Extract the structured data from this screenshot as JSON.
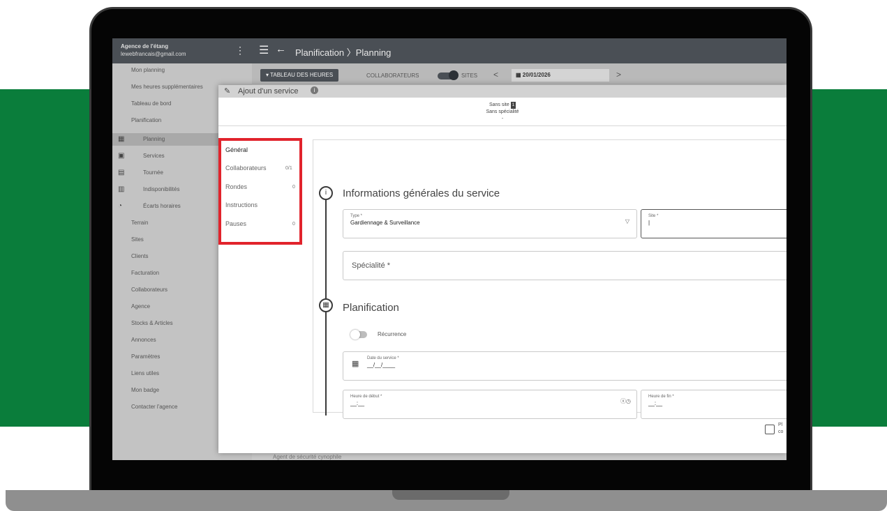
{
  "colors": {
    "green": "#0a7d3b",
    "highlight_red": "#e1232c",
    "topbar": "#4a4f55"
  },
  "account": {
    "agency_name": "Agence de l'étang",
    "email": "lewebfrancais@gmail.com"
  },
  "topbar": {
    "breadcrumb": "Planification 〉Planning",
    "menu_icon": "hamburger-icon",
    "back_icon": "arrow-left-icon"
  },
  "subbar": {
    "tableau": "TABLEAU DES HEURES",
    "collaborateurs": "COLLABORATEURS",
    "sites": "SITES",
    "prev": "<",
    "next": ">",
    "date": "20/01/2026"
  },
  "sidebar": {
    "mon_planning": "Mon planning",
    "mes_heures": "Mes heures supplémentaires",
    "tableau_de_bord": "Tableau de bord",
    "planification": "Planification",
    "planning": "Planning",
    "services": "Services",
    "tournee": "Tournée",
    "indisponibilites": "Indisponibilités",
    "ecarts": "Écarts horaires",
    "terrain": "Terrain",
    "sites": "Sites",
    "clients": "Clients",
    "facturation": "Facturation",
    "collaborateurs": "Collaborateurs",
    "agence": "Agence",
    "stocks": "Stocks & Articles",
    "annonces": "Annonces",
    "parametres": "Paramètres",
    "liens": "Liens utiles",
    "badge": "Mon badge",
    "contacter": "Contacter l'agence",
    "bottom_hint": "Agent de sécurité cynophile"
  },
  "modal": {
    "title": "Ajout d'un service",
    "info_icon": "i",
    "sans_site": "Sans site",
    "sans_site_count": "1",
    "sans_specialite": "Sans spécialité",
    "dash": "-",
    "tabs": [
      {
        "label": "Général",
        "count": ""
      },
      {
        "label": "Collaborateurs",
        "count": "0/1"
      },
      {
        "label": "Rondes",
        "count": "0"
      },
      {
        "label": "Instructions",
        "count": ""
      },
      {
        "label": "Pauses",
        "count": "0"
      }
    ],
    "section1": "Informations générales du service",
    "section1_icon": "i",
    "type_label": "Type *",
    "type_value": "Gardiennage & Surveillance",
    "site_label": "Site *",
    "specialite": "Spécialité *",
    "section2": "Planification",
    "recurrence": "Récurrence",
    "date_label": "Date du service *",
    "date_value": "__/__/____",
    "heure_debut": "Heure de début *",
    "heure_debut_value": "__:__",
    "heure_fin": "Heure de fin *",
    "heure_fin_value": "__:__",
    "cut_text_1": "Pl",
    "cut_text_2": "co"
  }
}
